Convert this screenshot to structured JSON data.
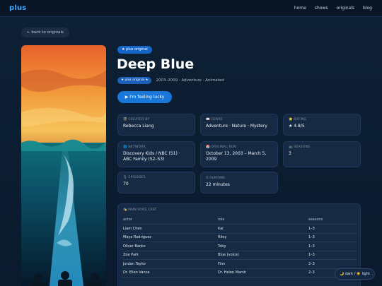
{
  "brand": "plus",
  "nav": {
    "home": "home",
    "shows": "shows",
    "originals": "originals",
    "blog": "blog"
  },
  "back_label": "← back to originals",
  "show": {
    "original_pill": "★ plus original",
    "title": "Deep Blue",
    "badge": "★ plus original ★",
    "meta": "2003–2009 · Adventure · Animated",
    "lucky_button": "▶ I'm feeling lucky"
  },
  "cards": {
    "created_by": {
      "label": "🎬 CREATED BY",
      "value": "Rebecca Liang"
    },
    "genre": {
      "label": "📖 GENRE",
      "value": "Adventure · Nature · Mystery"
    },
    "rating": {
      "label": "⭐ RATING",
      "value": "★ 4.8/5"
    },
    "network": {
      "label": "🌐 NETWORK",
      "value": "Discovery Kids / NBC (S1) · ABC Family (S2–S3)"
    },
    "original_run": {
      "label": "📅 ORIGINAL RUN",
      "value": "October 13, 2003 – March 5, 2009"
    },
    "seasons": {
      "label": "📺 SEASONS",
      "value": "3"
    },
    "episodes": {
      "label": "🎙 EPISODES",
      "value": "70"
    },
    "runtime": {
      "label": "⏱ RUNTIME",
      "value": "22 minutes"
    }
  },
  "cast": {
    "label": "🎭 MAIN VOICE CAST",
    "headers": [
      "actor",
      "role",
      "seasons"
    ],
    "rows": [
      [
        "Liam Chen",
        "Kai",
        "1–3"
      ],
      [
        "Maya Rodriguez",
        "Riley",
        "1–3"
      ],
      [
        "Oliver Banks",
        "Toby",
        "1–3"
      ],
      [
        "Zoe Park",
        "Blue (voice)",
        "1–3"
      ],
      [
        "Jordan Taylor",
        "Finn",
        "2–3"
      ],
      [
        "Dr. Ellen Vance",
        "Dr. Helen Marsh",
        "2–3"
      ]
    ]
  },
  "theme_toggle": "🌙 dark / ☀️ light"
}
